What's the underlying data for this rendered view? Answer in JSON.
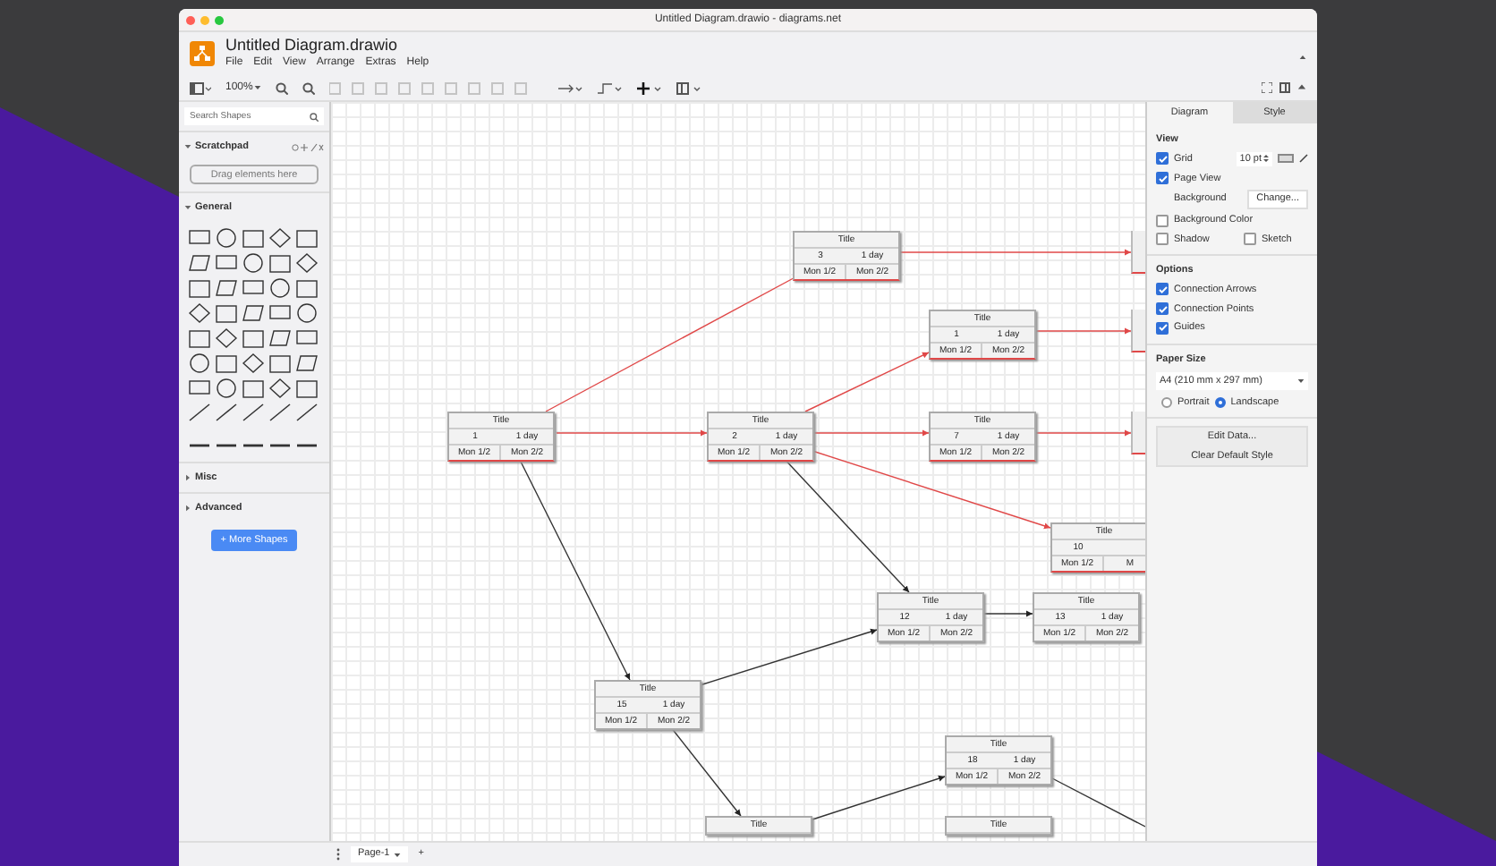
{
  "window": {
    "title": "Untitled Diagram.drawio - diagrams.net"
  },
  "header": {
    "file_name": "Untitled Diagram.drawio",
    "menu": [
      "File",
      "Edit",
      "View",
      "Arrange",
      "Extras",
      "Help"
    ]
  },
  "toolbar": {
    "zoom": "100%"
  },
  "sidebar": {
    "search": {
      "placeholder": "Search Shapes"
    },
    "sections": [
      {
        "label": "Scratchpad",
        "expanded": true,
        "kind": "scratchpad",
        "hint": "Drag elements here"
      },
      {
        "label": "General",
        "expanded": true,
        "kind": "shapes"
      },
      {
        "label": "Misc",
        "expanded": false,
        "kind": "plain"
      },
      {
        "label": "Advanced",
        "expanded": false,
        "kind": "plain"
      }
    ],
    "more_button": "+ More Shapes"
  },
  "diagram": {
    "nodes": [
      {
        "kind": "task",
        "critical": true,
        "title": "Title",
        "id_text": "3",
        "duration": "1 day",
        "start": "Mon 1/2",
        "end": "Mon 2/2"
      },
      {
        "kind": "task",
        "critical": true,
        "title": "Title",
        "id_text": "1",
        "duration": "1 day",
        "start": "Mon 1/2",
        "end": "Mon 2/2"
      },
      {
        "kind": "task",
        "critical": true,
        "title": "Title",
        "id_text": "1",
        "duration": "1 day",
        "start": "Mon 1/2",
        "end": "Mon 2/2"
      },
      {
        "kind": "task",
        "critical": true,
        "title": "Title",
        "id_text": "2",
        "duration": "1 day",
        "start": "Mon 1/2",
        "end": "Mon 2/2"
      },
      {
        "kind": "task",
        "critical": true,
        "title": "Title",
        "id_text": "7",
        "duration": "1 day",
        "start": "Mon 1/2",
        "end": "Mon 2/2"
      },
      {
        "kind": "task",
        "critical": true,
        "title": "Title",
        "id_text": "10",
        "start": "Mon 1/2",
        "end": "M"
      },
      {
        "kind": "task",
        "critical": false,
        "title": "Title",
        "id_text": "12",
        "duration": "1 day",
        "start": "Mon 1/2",
        "end": "Mon 2/2"
      },
      {
        "kind": "task",
        "critical": false,
        "title": "Title",
        "id_text": "13",
        "duration": "1 day",
        "start": "Mon 1/2",
        "end": "Mon 2/2"
      },
      {
        "kind": "task",
        "critical": false,
        "title": "Title",
        "id_text": "15",
        "duration": "1 day",
        "start": "Mon 1/2",
        "end": "Mon 2/2"
      },
      {
        "kind": "task",
        "critical": false,
        "title": "Title",
        "id_text": "18",
        "duration": "1 day",
        "start": "Mon 1/2",
        "end": "Mon 2/2"
      },
      {
        "kind": "task",
        "critical": false,
        "title": "Title"
      },
      {
        "kind": "task",
        "critical": false,
        "title": "Title"
      },
      {
        "kind": "cut",
        "critical": true
      },
      {
        "kind": "cut",
        "critical": true
      },
      {
        "kind": "cut",
        "critical": true
      }
    ]
  },
  "format_panel": {
    "tabs": [
      {
        "label": "Diagram",
        "selected": true
      },
      {
        "label": "Style",
        "selected": false
      }
    ],
    "view_heading": "View",
    "grid": {
      "label": "Grid",
      "checked": true,
      "size": "10 pt"
    },
    "page_view": {
      "label": "Page View",
      "checked": true
    },
    "background": {
      "label": "Background",
      "button": "Change..."
    },
    "background_color": {
      "label": "Background Color",
      "checked": false
    },
    "shadow": {
      "label": "Shadow",
      "checked": false
    },
    "sketch": {
      "label": "Sketch",
      "checked": false
    },
    "options_heading": "Options",
    "options": [
      {
        "label": "Connection Arrows",
        "checked": true
      },
      {
        "label": "Connection Points",
        "checked": true
      },
      {
        "label": "Guides",
        "checked": true
      }
    ],
    "paper_heading": "Paper Size",
    "paper_size": "A4 (210 mm x 297 mm)",
    "orientation": [
      {
        "label": "Portrait",
        "selected": false
      },
      {
        "label": "Landscape",
        "selected": true
      }
    ],
    "buttons": [
      "Edit Data...",
      "Clear Default Style"
    ]
  },
  "pages": {
    "tabs": [
      {
        "label": "Page-1",
        "selected": true
      }
    ],
    "add": "+"
  }
}
